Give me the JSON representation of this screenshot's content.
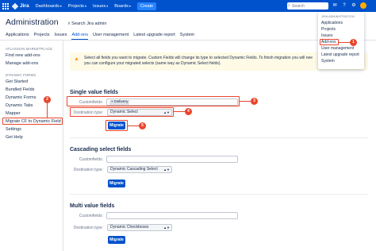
{
  "topnav": {
    "logo": "Jira",
    "items": [
      "Dashboards",
      "Projects",
      "Issues",
      "Boards"
    ],
    "create": "Create",
    "search_placeholder": "Search"
  },
  "header": {
    "title": "Administration",
    "search_admin": "Search Jira admin"
  },
  "tabs": [
    "Applications",
    "Projects",
    "Issues",
    "Add-ons",
    "User management",
    "Latest upgrade report",
    "System"
  ],
  "active_tab": "Add-ons",
  "sidebar": {
    "heading_marketplace": "ATLASSIAN MARKETPLACE",
    "marketplace_items": [
      "Find new add-ons",
      "Manage add-ons"
    ],
    "heading_dynamic": "DYNAMIC FORMS",
    "dynamic_items": [
      "Get Started",
      "Bundled Fields",
      "Dynamic Forms",
      "Dynamic Tabs",
      "Mapper",
      "Migrate CF to Dynamic Field",
      "Settings",
      "Get Help"
    ]
  },
  "admin_menu": {
    "heading": "JIRA ADMINISTRATION",
    "items": [
      "Applications",
      "Projects",
      "Issues",
      "Add-ons",
      "User management",
      "Latest upgrade report",
      "System"
    ]
  },
  "warning": {
    "line1": "Select all fields you want to migrate. Custom Fields will change its type to selected Dynamic Fields. To finish migration you will nee",
    "line2": "you can configure your migrated selects (same way as Dynamic Select fields)."
  },
  "single": {
    "title": "Single value fields",
    "cf_label": "Customfields:",
    "cf_tag": "Delivery",
    "dest_label": "Destination type:",
    "dest_value": "Dynamic Select",
    "button": "Migrate"
  },
  "cascading": {
    "title": "Cascading select fields",
    "cf_label": "Customfields:",
    "dest_label": "Destination type:",
    "dest_value": "Dynamic Cascading Select",
    "button": "Migrate"
  },
  "multi": {
    "title": "Multi value fields",
    "cf_label": "Customfields:",
    "dest_label": "Destination type:",
    "dest_value": "Dynamic Checkboxes",
    "button": "Migrate"
  },
  "callouts": [
    "1",
    "2",
    "3",
    "4",
    "5"
  ],
  "colors": {
    "nav": "#0052cc",
    "callout": "#e8452c",
    "warning_bg": "#fffae6"
  }
}
